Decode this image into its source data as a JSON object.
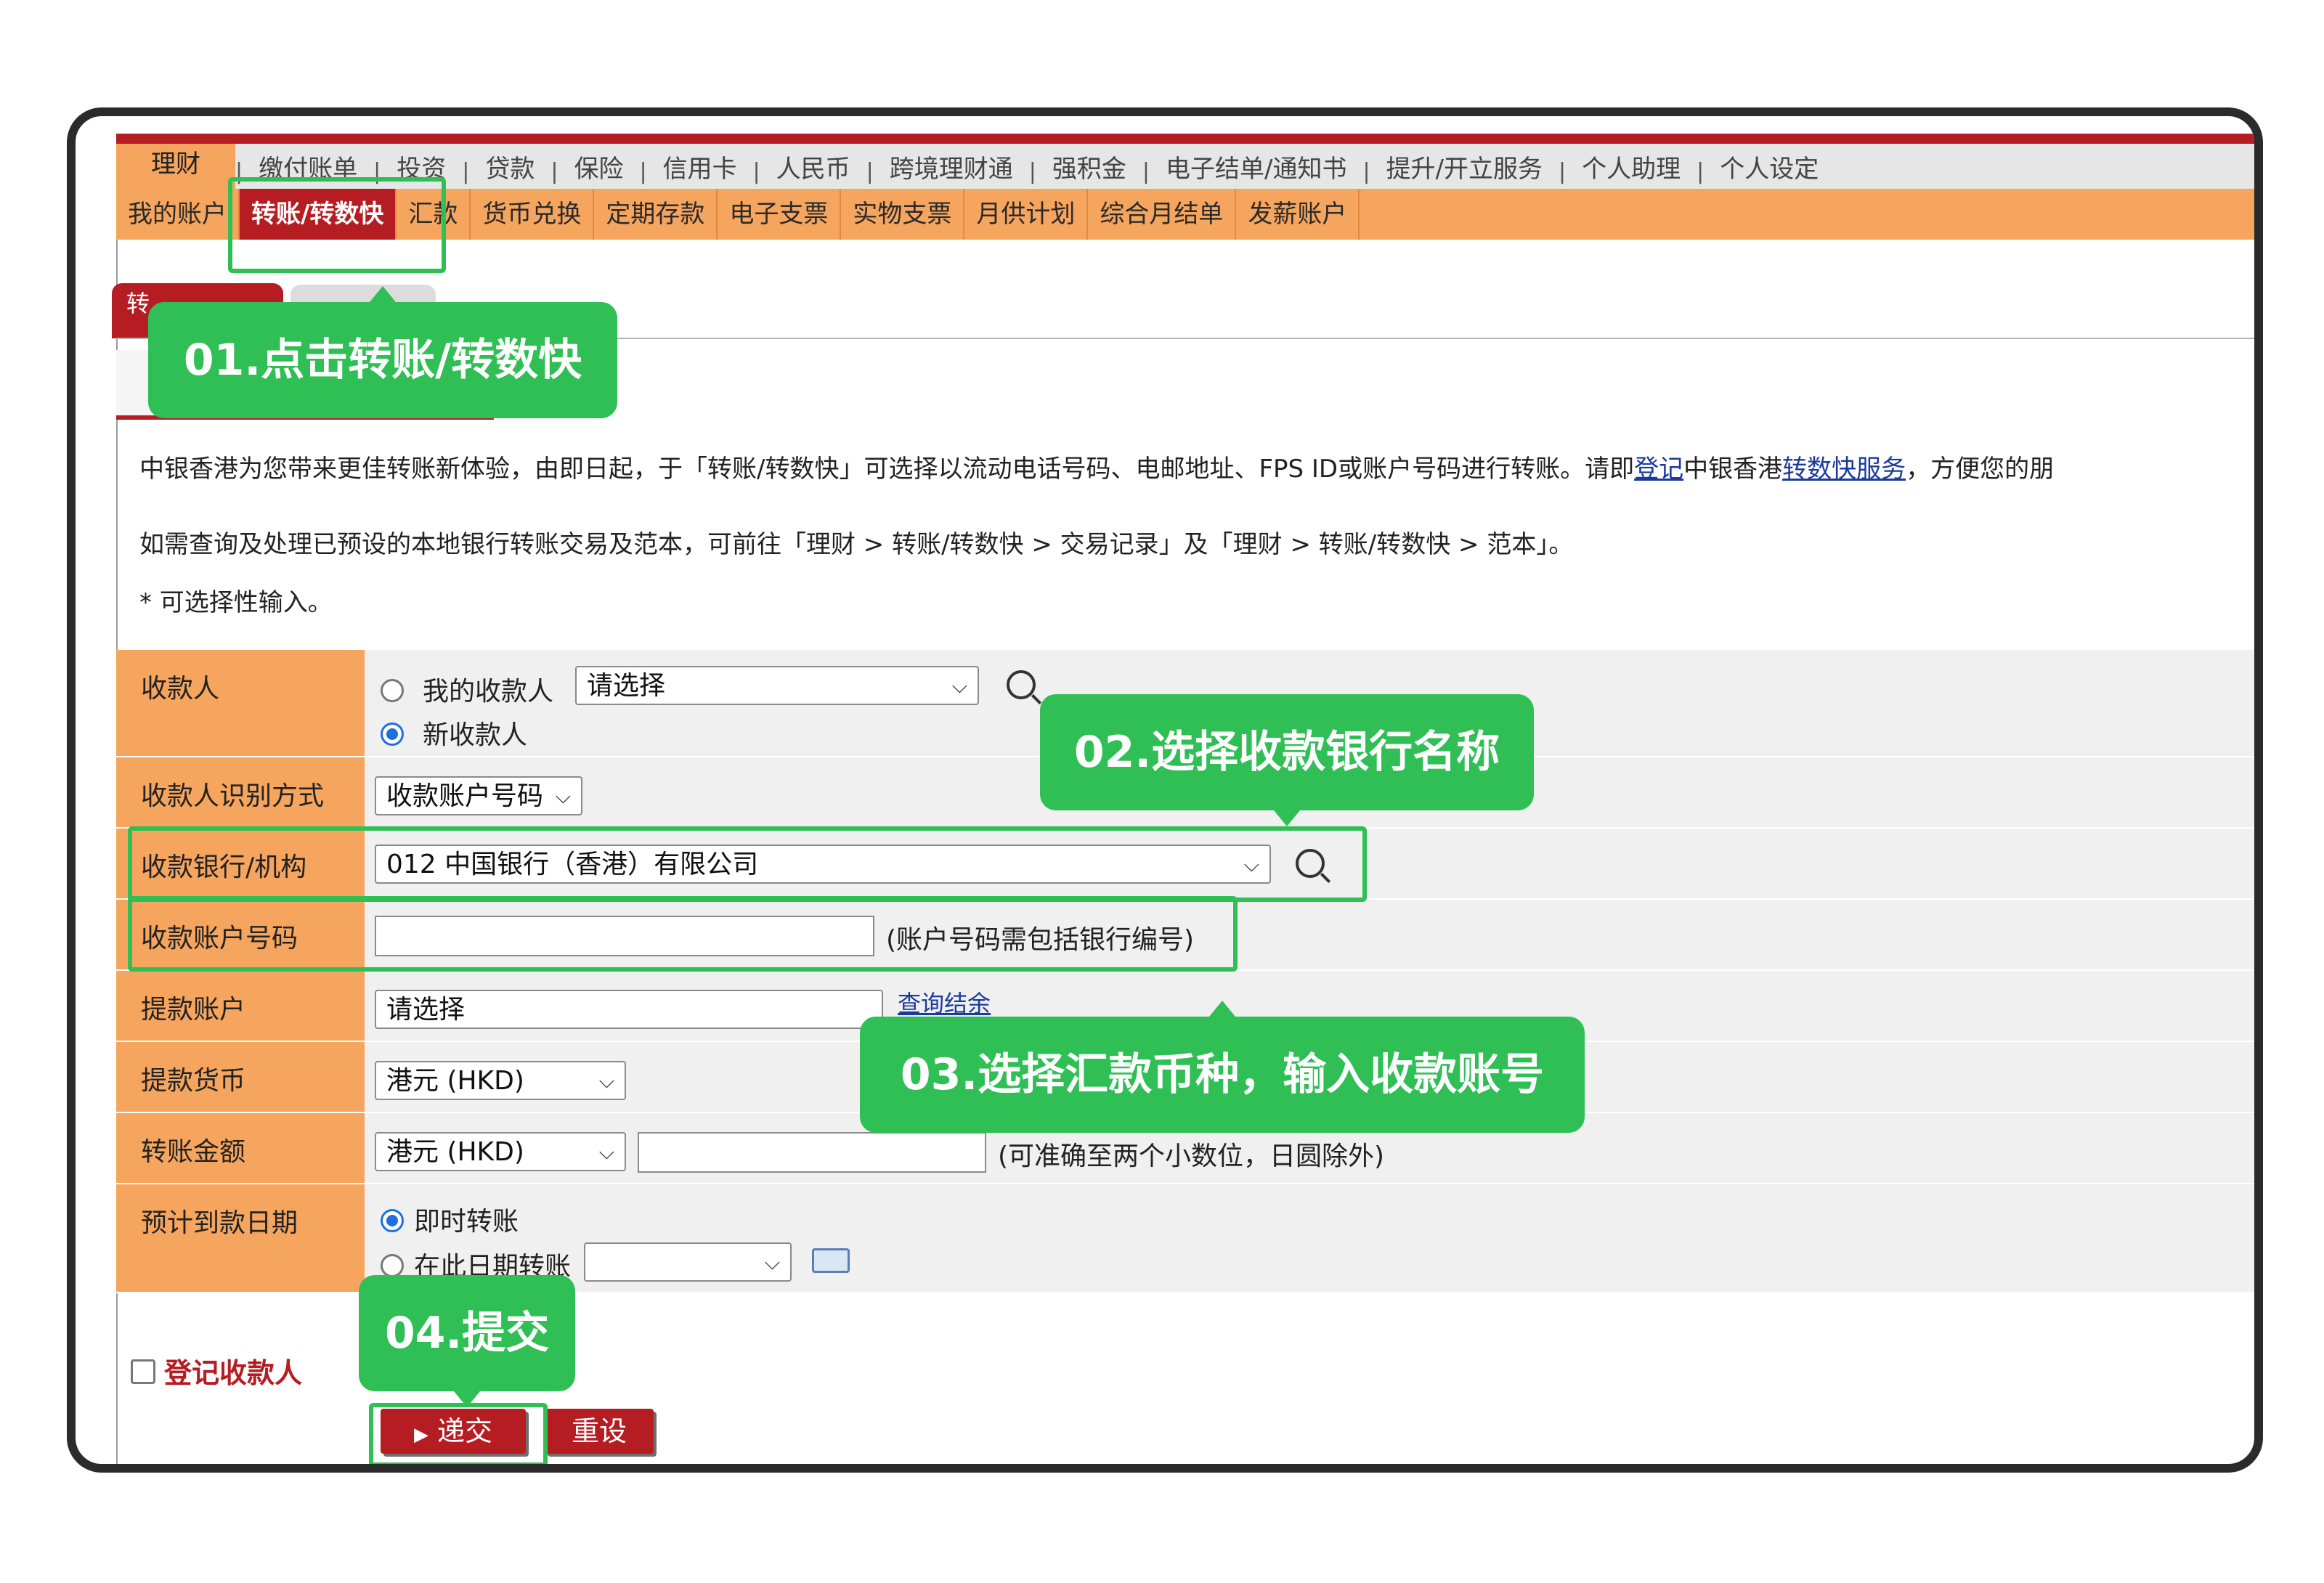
{
  "nav_primary": [
    "理财",
    "缴付账单",
    "投资",
    "贷款",
    "保险",
    "信用卡",
    "人民币",
    "跨境理财通",
    "强积金",
    "电子结单/通知书",
    "提升/开立服务",
    "个人助理",
    "个人设定"
  ],
  "nav_secondary": [
    "我的账户",
    "转账/转数快",
    "汇款",
    "货币兑换",
    "定期存款",
    "电子支票",
    "实物支票",
    "月供计划",
    "综合月结单",
    "发薪账户"
  ],
  "subtab_label": "转",
  "intro": {
    "p1_a": "中银香港为您带来更佳转账新体验，由即日起，于「转账/转数快」可选择以流动电话号码、电邮地址、FPS ID或账户号码进行转账。请即",
    "p1_link1": "登记",
    "p1_b": "中银香港",
    "p1_link2": "转数快服务",
    "p1_c": "，方便您的朋",
    "p2": "如需查询及处理已预设的本地银行转账交易及范本，可前往「理财 > 转账/转数快 > 交易记录」及「理财 > 转账/转数快 > 范本」。",
    "p3": "* 可选择性输入。"
  },
  "form": {
    "payee_label": "收款人",
    "payee_opt_mine": "我的收款人",
    "payee_select": "请选择",
    "payee_opt_new": "新收款人",
    "id_method_label": "收款人识别方式",
    "id_method_value": "收款账户号码",
    "bank_label": "收款银行/机构",
    "bank_value": "012 中国银行（香港）有限公司",
    "acct_label": "收款账户号码",
    "acct_hint": "(账户号码需包括银行编号)",
    "debit_label": "提款账户",
    "debit_value": "请选择",
    "debit_link": "查询结余",
    "currency_label": "提款货币",
    "currency_value": "港元 (HKD)",
    "amount_label": "转账金额",
    "amount_currency": "港元 (HKD)",
    "amount_hint": "(可准确至两个小数位，日圆除外)",
    "date_label": "预计到款日期",
    "date_opt_now": "即时转账",
    "date_opt_later": "在此日期转账",
    "register_payee": "登记收款人",
    "submit": "递交",
    "reset": "重设"
  },
  "callouts": {
    "c1": "01.点击转账/转数快",
    "c2": "02.选择收款银行名称",
    "c3": "03.选择汇款币种，输入收款账号",
    "c4": "04.提交"
  },
  "colors": {
    "brand_red": "#b51d22",
    "nav_orange": "#f6a55e",
    "callout_green": "#2fbf55"
  }
}
